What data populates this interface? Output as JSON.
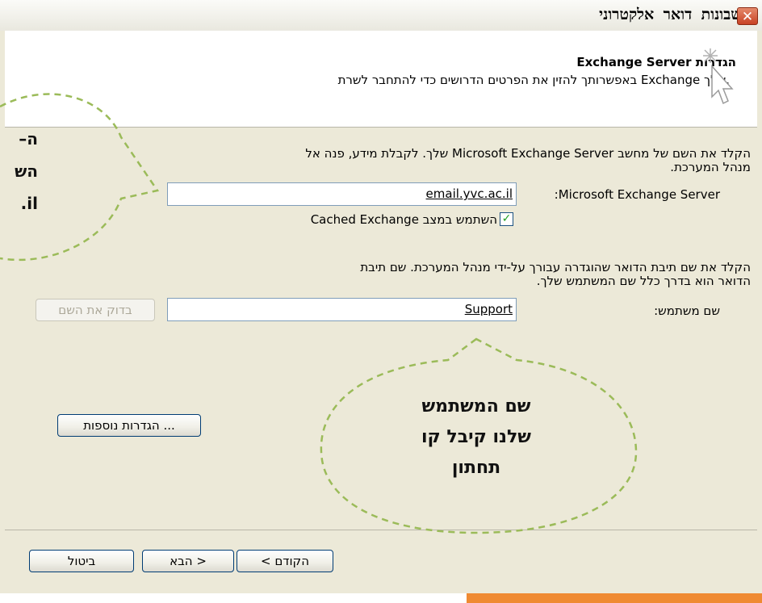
{
  "window": {
    "title": "חשבונות דואר אלקטרוני",
    "close_glyph": "✕"
  },
  "header": {
    "title": "הגדרות Exchange Server",
    "subtitle": ".שלך Exchange באפשרותך להזין את הפרטים הדרושים כדי להתחבר לשרת",
    "icon": "cursor-sparkle-icon"
  },
  "server_section": {
    "instruction_line1": "הקלד את השם של מחשב Microsoft Exchange Server שלך. לקבלת מידע, פנה אל",
    "instruction_line2": "מנהל המערכת.",
    "label": "Microsoft Exchange Server:",
    "value": "email.yvc.ac.il",
    "cached_label": "השתמש במצב Cached Exchange",
    "cached_checked": true,
    "check_glyph": "✓"
  },
  "user_section": {
    "instruction_line1": "הקלד את שם תיבת הדואר שהוגדרה עבורך על-ידי מנהל המערכת. שם תיבת",
    "instruction_line2": "הדואר הוא בדרך כלל שם המשתמש שלך.",
    "label": "שם משתמש:",
    "value": "Support",
    "check_name_button": "בדוק את השם"
  },
  "more_settings_button": "הגדרות נוספות ...",
  "footer": {
    "back_button": "< הקודם",
    "next_button": "הבא >",
    "cancel_button": "ביטול"
  },
  "callouts": {
    "right_bubble_lines": [
      "שם המשתמש",
      "שלנו קיבל קו",
      "תחתון"
    ],
    "left_bubble_lines": [
      "ה–",
      "הש",
      "il."
    ],
    "stroke_color": "#9bbb59"
  },
  "colors": {
    "accent_bar": "#ef8a32",
    "dialog_bg": "#ece9d8",
    "close_button": "#d2502f"
  }
}
